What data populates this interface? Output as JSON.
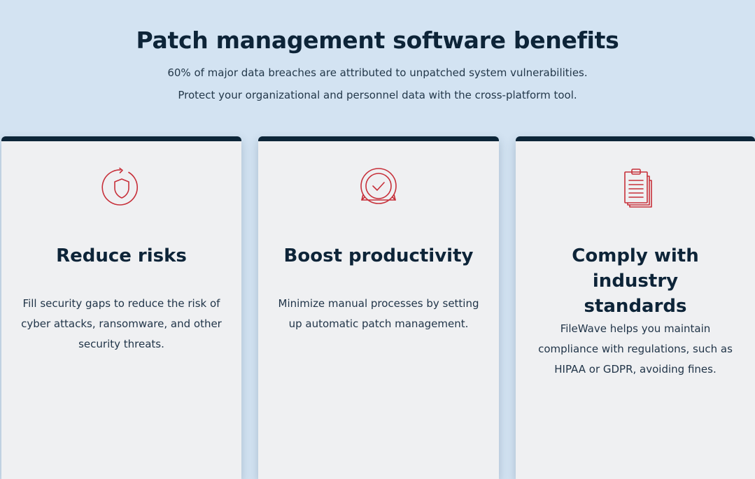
{
  "header": {
    "title": "Patch management software benefits",
    "subtitle_line1": "60% of major data breaches are attributed to unpatched system vulnerabilities.",
    "subtitle_line2": "Protect your organizational and personnel data with the cross-platform tool."
  },
  "colors": {
    "background": "#d3e3f2",
    "card_background": "#eff0f2",
    "card_top_border": "#0c2538",
    "icon_accent": "#c7303a",
    "heading": "#0d2438"
  },
  "cards": [
    {
      "icon": "shield-refresh-icon",
      "title": "Reduce risks",
      "text": "Fill security gaps to reduce the risk of cyber attacks, ransomware, and other security threats."
    },
    {
      "icon": "badge-check-icon",
      "title": "Boost productivity",
      "text": "Minimize manual processes by setting up automatic patch management."
    },
    {
      "icon": "clipboard-list-icon",
      "title": "Comply with industry standards",
      "text": "FileWave helps you maintain compliance with regulations, such as HIPAA or GDPR, avoiding fines."
    }
  ]
}
